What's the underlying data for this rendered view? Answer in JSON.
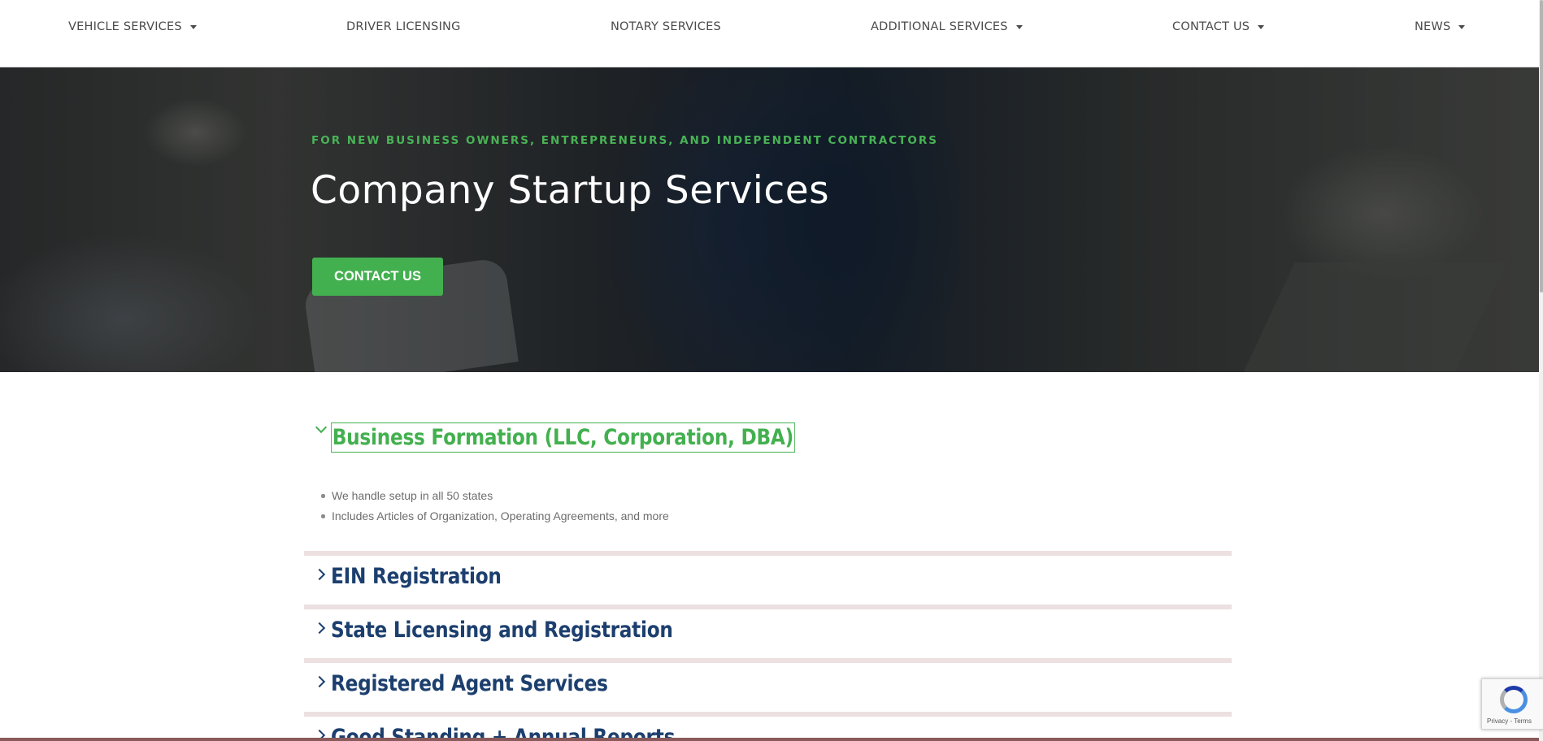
{
  "nav": {
    "items": [
      {
        "label": "VEHICLE SERVICES",
        "has_dropdown": true
      },
      {
        "label": "DRIVER LICENSING",
        "has_dropdown": false
      },
      {
        "label": "NOTARY SERVICES",
        "has_dropdown": false
      },
      {
        "label": "ADDITIONAL SERVICES",
        "has_dropdown": true
      },
      {
        "label": "CONTACT US",
        "has_dropdown": true
      },
      {
        "label": "NEWS",
        "has_dropdown": true
      }
    ]
  },
  "hero": {
    "eyebrow": "FOR NEW BUSINESS OWNERS, ENTREPRENEURS, AND INDEPENDENT CONTRACTORS",
    "title": "Company Startup Services",
    "button_label": "CONTACT US"
  },
  "accordion": {
    "active": {
      "title": "Business Formation (LLC, Corporation, DBA)",
      "items": [
        "We handle setup in all 50 states",
        "Includes Articles of Organization, Operating Agreements, and more"
      ]
    },
    "sections": [
      {
        "title": "EIN Registration"
      },
      {
        "title": "State Licensing and Registration"
      },
      {
        "title": "Registered Agent Services"
      },
      {
        "title": "Good Standing + Annual Reports"
      }
    ]
  },
  "recaptcha": {
    "text": "Privacy - Terms"
  },
  "colors": {
    "accent_green": "#43b04f",
    "heading_navy": "#1c3f6e",
    "divider": "#ece0e0"
  }
}
